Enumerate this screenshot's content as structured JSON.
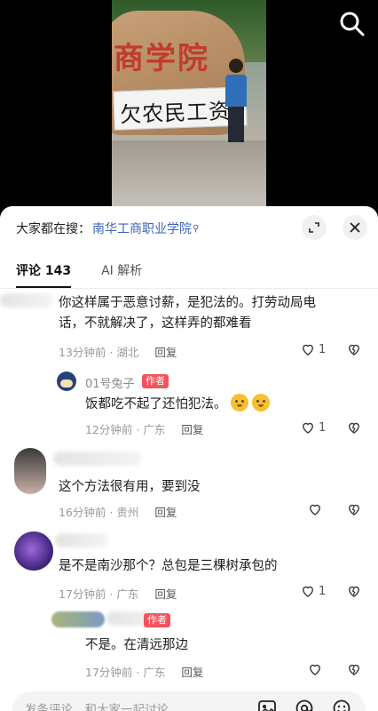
{
  "video": {
    "rock_text": "商学院",
    "banner_text": "欠农民工资"
  },
  "icons": {
    "search": "search-icon",
    "expand": "expand-icon",
    "close": "close-icon",
    "like": "heart-outline-icon",
    "dislike": "broken-heart-icon",
    "image": "image-icon",
    "mention": "at-icon",
    "emoji": "emoji-icon"
  },
  "sheet": {
    "hot_prefix": "大家都在搜：",
    "hot_link": "南华工商职业学院",
    "tabs": [
      {
        "label": "评论 143"
      },
      {
        "label": "AI 解析"
      }
    ]
  },
  "comments": [
    {
      "text_line1": "你这样属于恶意讨薪，是犯法的。打劳动局电",
      "text_line2": "话，不就解决了，这样弄的都难看",
      "meta": "13分钟前 · 湖北",
      "reply": "回复",
      "likes": "1"
    },
    {
      "author": "01号兔子",
      "tag": "作者",
      "text": "饭都吃不起了还怕犯法。",
      "meta": "12分钟前 · 广东",
      "reply": "回复",
      "likes": "1"
    },
    {
      "text": "这个方法很有用，要到没",
      "meta": "16分钟前 · 贵州",
      "reply": "回复",
      "likes": ""
    },
    {
      "text": "是不是南沙那个？总包是三棵树承包的",
      "meta": "17分钟前 · 广东",
      "reply": "回复",
      "likes": "1"
    },
    {
      "tag": "作者",
      "text": "不是。在清远那边",
      "meta": "17分钟前 · 广东",
      "reply": "回复",
      "likes": ""
    }
  ],
  "input": {
    "placeholder": "发条评论，和大家一起讨论"
  },
  "colors": {
    "link": "#3d64b5",
    "author_tag": "#f2545b"
  }
}
